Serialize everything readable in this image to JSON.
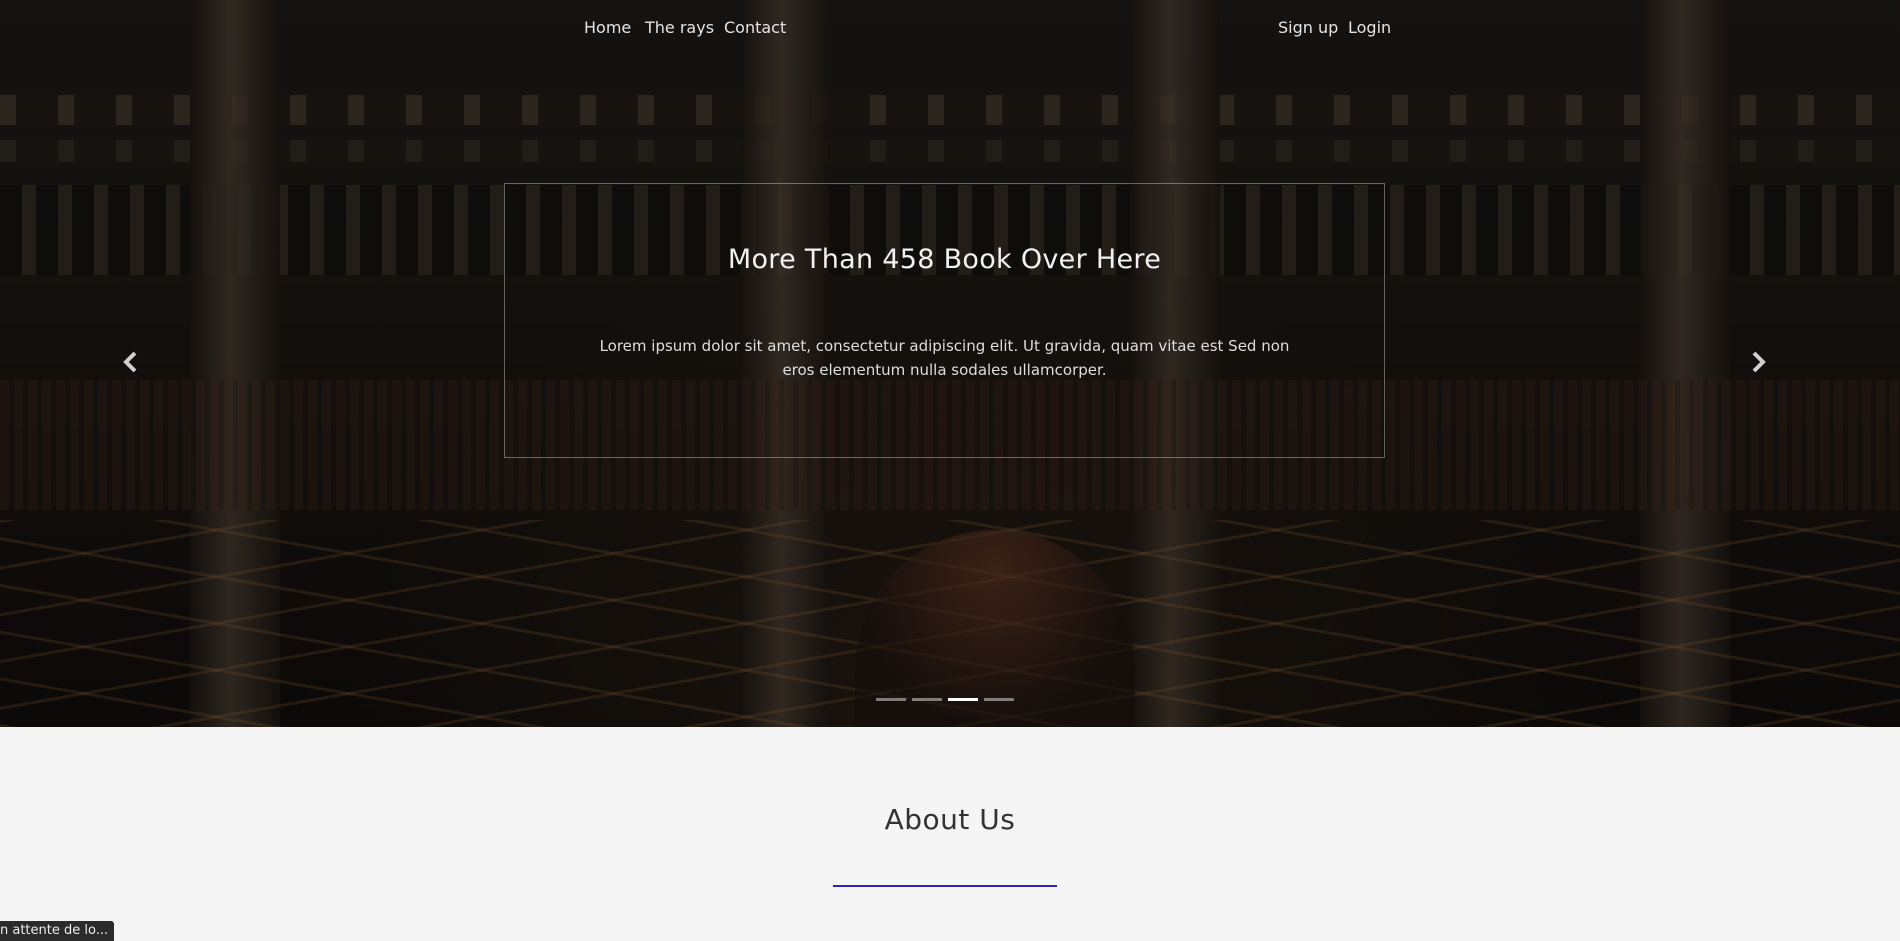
{
  "nav": {
    "home": "Home",
    "rays": "The rays",
    "contact": "Contact",
    "signup": "Sign up",
    "login": "Login"
  },
  "carousel": {
    "title": "More Than 458 Book Over Here",
    "text": "Lorem ipsum dolor sit amet, consectetur adipiscing elit. Ut gravida, quam vitae est Sed non eros elementum nulla sodales ullamcorper.",
    "prev_icon": "chevron-left-icon",
    "next_icon": "chevron-right-icon",
    "slide_count": 4,
    "active_index": 2
  },
  "about": {
    "title": "About Us",
    "accent_color": "#3a1fb0"
  },
  "status_bar": {
    "text": "n attente de lo..."
  }
}
